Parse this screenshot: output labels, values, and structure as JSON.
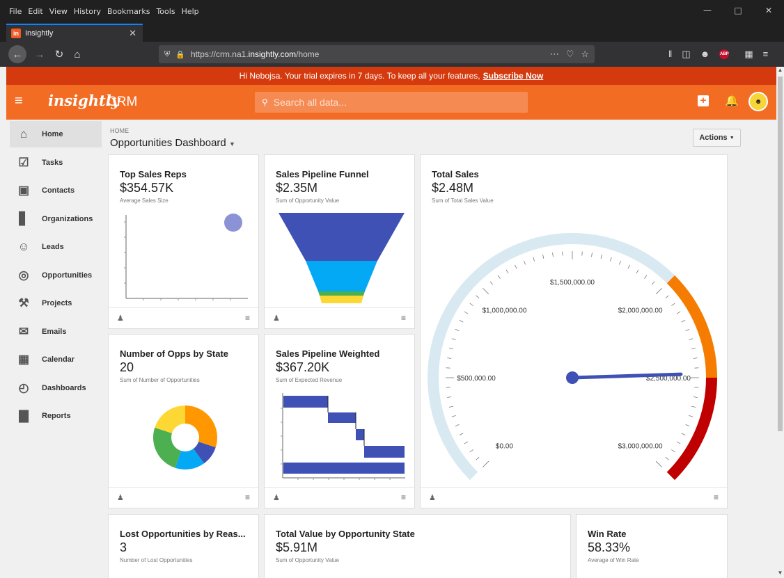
{
  "browser": {
    "menu": [
      "File",
      "Edit",
      "View",
      "History",
      "Bookmarks",
      "Tools",
      "Help"
    ],
    "tab_title": "Insightly",
    "url_prefix": "https://crm.na1.",
    "url_host": "insightly.com",
    "url_suffix": "/home"
  },
  "banner": {
    "text": "Hi Nebojsa. Your trial expires in 7 days. To keep all your features,",
    "link": "Subscribe Now"
  },
  "header": {
    "logo": "insightly",
    "product": "CRM",
    "search_placeholder": "Search all data..."
  },
  "sidebar": {
    "items": [
      {
        "label": "Home",
        "icon": "home-icon"
      },
      {
        "label": "Tasks",
        "icon": "tasks-icon"
      },
      {
        "label": "Contacts",
        "icon": "contacts-icon"
      },
      {
        "label": "Organizations",
        "icon": "building-icon"
      },
      {
        "label": "Leads",
        "icon": "leads-icon"
      },
      {
        "label": "Opportunities",
        "icon": "target-icon"
      },
      {
        "label": "Projects",
        "icon": "hammer-icon"
      },
      {
        "label": "Emails",
        "icon": "envelope-icon"
      },
      {
        "label": "Calendar",
        "icon": "calendar-icon"
      },
      {
        "label": "Dashboards",
        "icon": "gauge-icon"
      },
      {
        "label": "Reports",
        "icon": "bar-chart-icon"
      }
    ]
  },
  "page": {
    "breadcrumb": "HOME",
    "title": "Opportunities Dashboard",
    "actions_label": "Actions"
  },
  "cards": {
    "top_sales": {
      "title": "Top Sales Reps",
      "value": "$354.57K",
      "sub": "Average Sales Size"
    },
    "funnel": {
      "title": "Sales Pipeline Funnel",
      "value": "$2.35M",
      "sub": "Sum of Opportunity Value"
    },
    "total_sales": {
      "title": "Total Sales",
      "value": "$2.48M",
      "sub": "Sum of Total Sales Value"
    },
    "opps_state": {
      "title": "Number of Opps by State",
      "value": "20",
      "sub": "Sum of Number of Opportunities"
    },
    "weighted": {
      "title": "Sales Pipeline Weighted",
      "value": "$367.20K",
      "sub": "Sum of Expected Revenue"
    },
    "lost": {
      "title": "Lost Opportunities by Reas...",
      "value": "3",
      "sub": "Number of Lost Opportunities"
    },
    "total_value": {
      "title": "Total Value by Opportunity State",
      "value": "$5.91M",
      "sub": "Sum of Opportunity Value"
    },
    "win_rate": {
      "title": "Win Rate",
      "value": "58.33%",
      "sub": "Average of Win Rate"
    }
  },
  "gauge": {
    "min": 0,
    "max": 3000000,
    "value": 2480000,
    "labels": [
      "$0.00",
      "$500,000.00",
      "$1,000,000.00",
      "$1,500,000.00",
      "$2,000,000.00",
      "$2,500,000.00",
      "$3,000,000.00"
    ],
    "bands": [
      {
        "from": 0,
        "to": 2000000,
        "color": "#d8e9f1"
      },
      {
        "from": 2000000,
        "to": 2500000,
        "color": "#f57c00"
      },
      {
        "from": 2500000,
        "to": 3000000,
        "color": "#c00000"
      }
    ],
    "needle_color": "#3f51b5"
  },
  "donut": {
    "colors": [
      "#ff9800",
      "#3f51b5",
      "#03a9f4",
      "#4caf50",
      "#fdd835"
    ],
    "fractions": [
      0.3,
      0.1,
      0.15,
      0.25,
      0.2
    ]
  },
  "colors": {
    "accent": "#f36c24",
    "banner": "#d43a0e",
    "funnel": [
      "#3f51b5",
      "#03a9f4",
      "#4caf50",
      "#fdd835"
    ],
    "bars": "#3f51b5"
  }
}
